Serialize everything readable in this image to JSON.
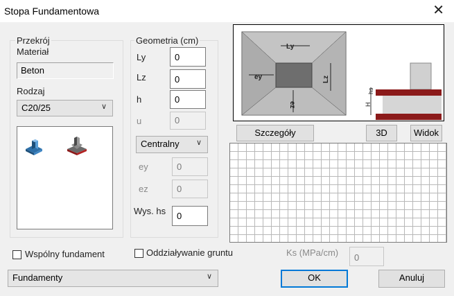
{
  "window": {
    "title": "Stopa Fundamentowa",
    "close_glyph": "✕"
  },
  "section": {
    "przekroj_title": "Przekrój",
    "material_label": "Materiał",
    "material_value": "Beton",
    "rodzaj_label": "Rodzaj",
    "rodzaj_value": "C20/25"
  },
  "geometry": {
    "title": "Geometria (cm)",
    "ly_label": "Ly",
    "ly_value": "0",
    "lz_label": "Lz",
    "lz_value": "0",
    "h_label": "h",
    "h_value": "0",
    "u_label": "u",
    "u_value": "0",
    "position_value": "Centralny",
    "ey_label": "ey",
    "ey_value": "0",
    "ez_label": "ez",
    "ez_value": "0",
    "hs_label": "Wys. hs",
    "hs_value": "0"
  },
  "preview": {
    "ly_text": "Ly",
    "lz_text": "Lz",
    "ey_text": "ey",
    "ez_text": "ez",
    "hs_text": "hs",
    "h_text": "H"
  },
  "buttons": {
    "details": "Szczegóły",
    "view_3d": "3D",
    "view": "Widok",
    "ok": "OK",
    "cancel": "Anuluj"
  },
  "bottom": {
    "shared_foundation": "Wspólny fundament",
    "soil_interaction": "Oddziaływanie gruntu",
    "ks_label": "Ks (MPa/cm)",
    "ks_value": "0",
    "category_value": "Fundamenty"
  },
  "colors": {
    "accent": "#0078d7",
    "grid_line": "#b8b8b8",
    "footing_red": "#8b1a1a"
  }
}
